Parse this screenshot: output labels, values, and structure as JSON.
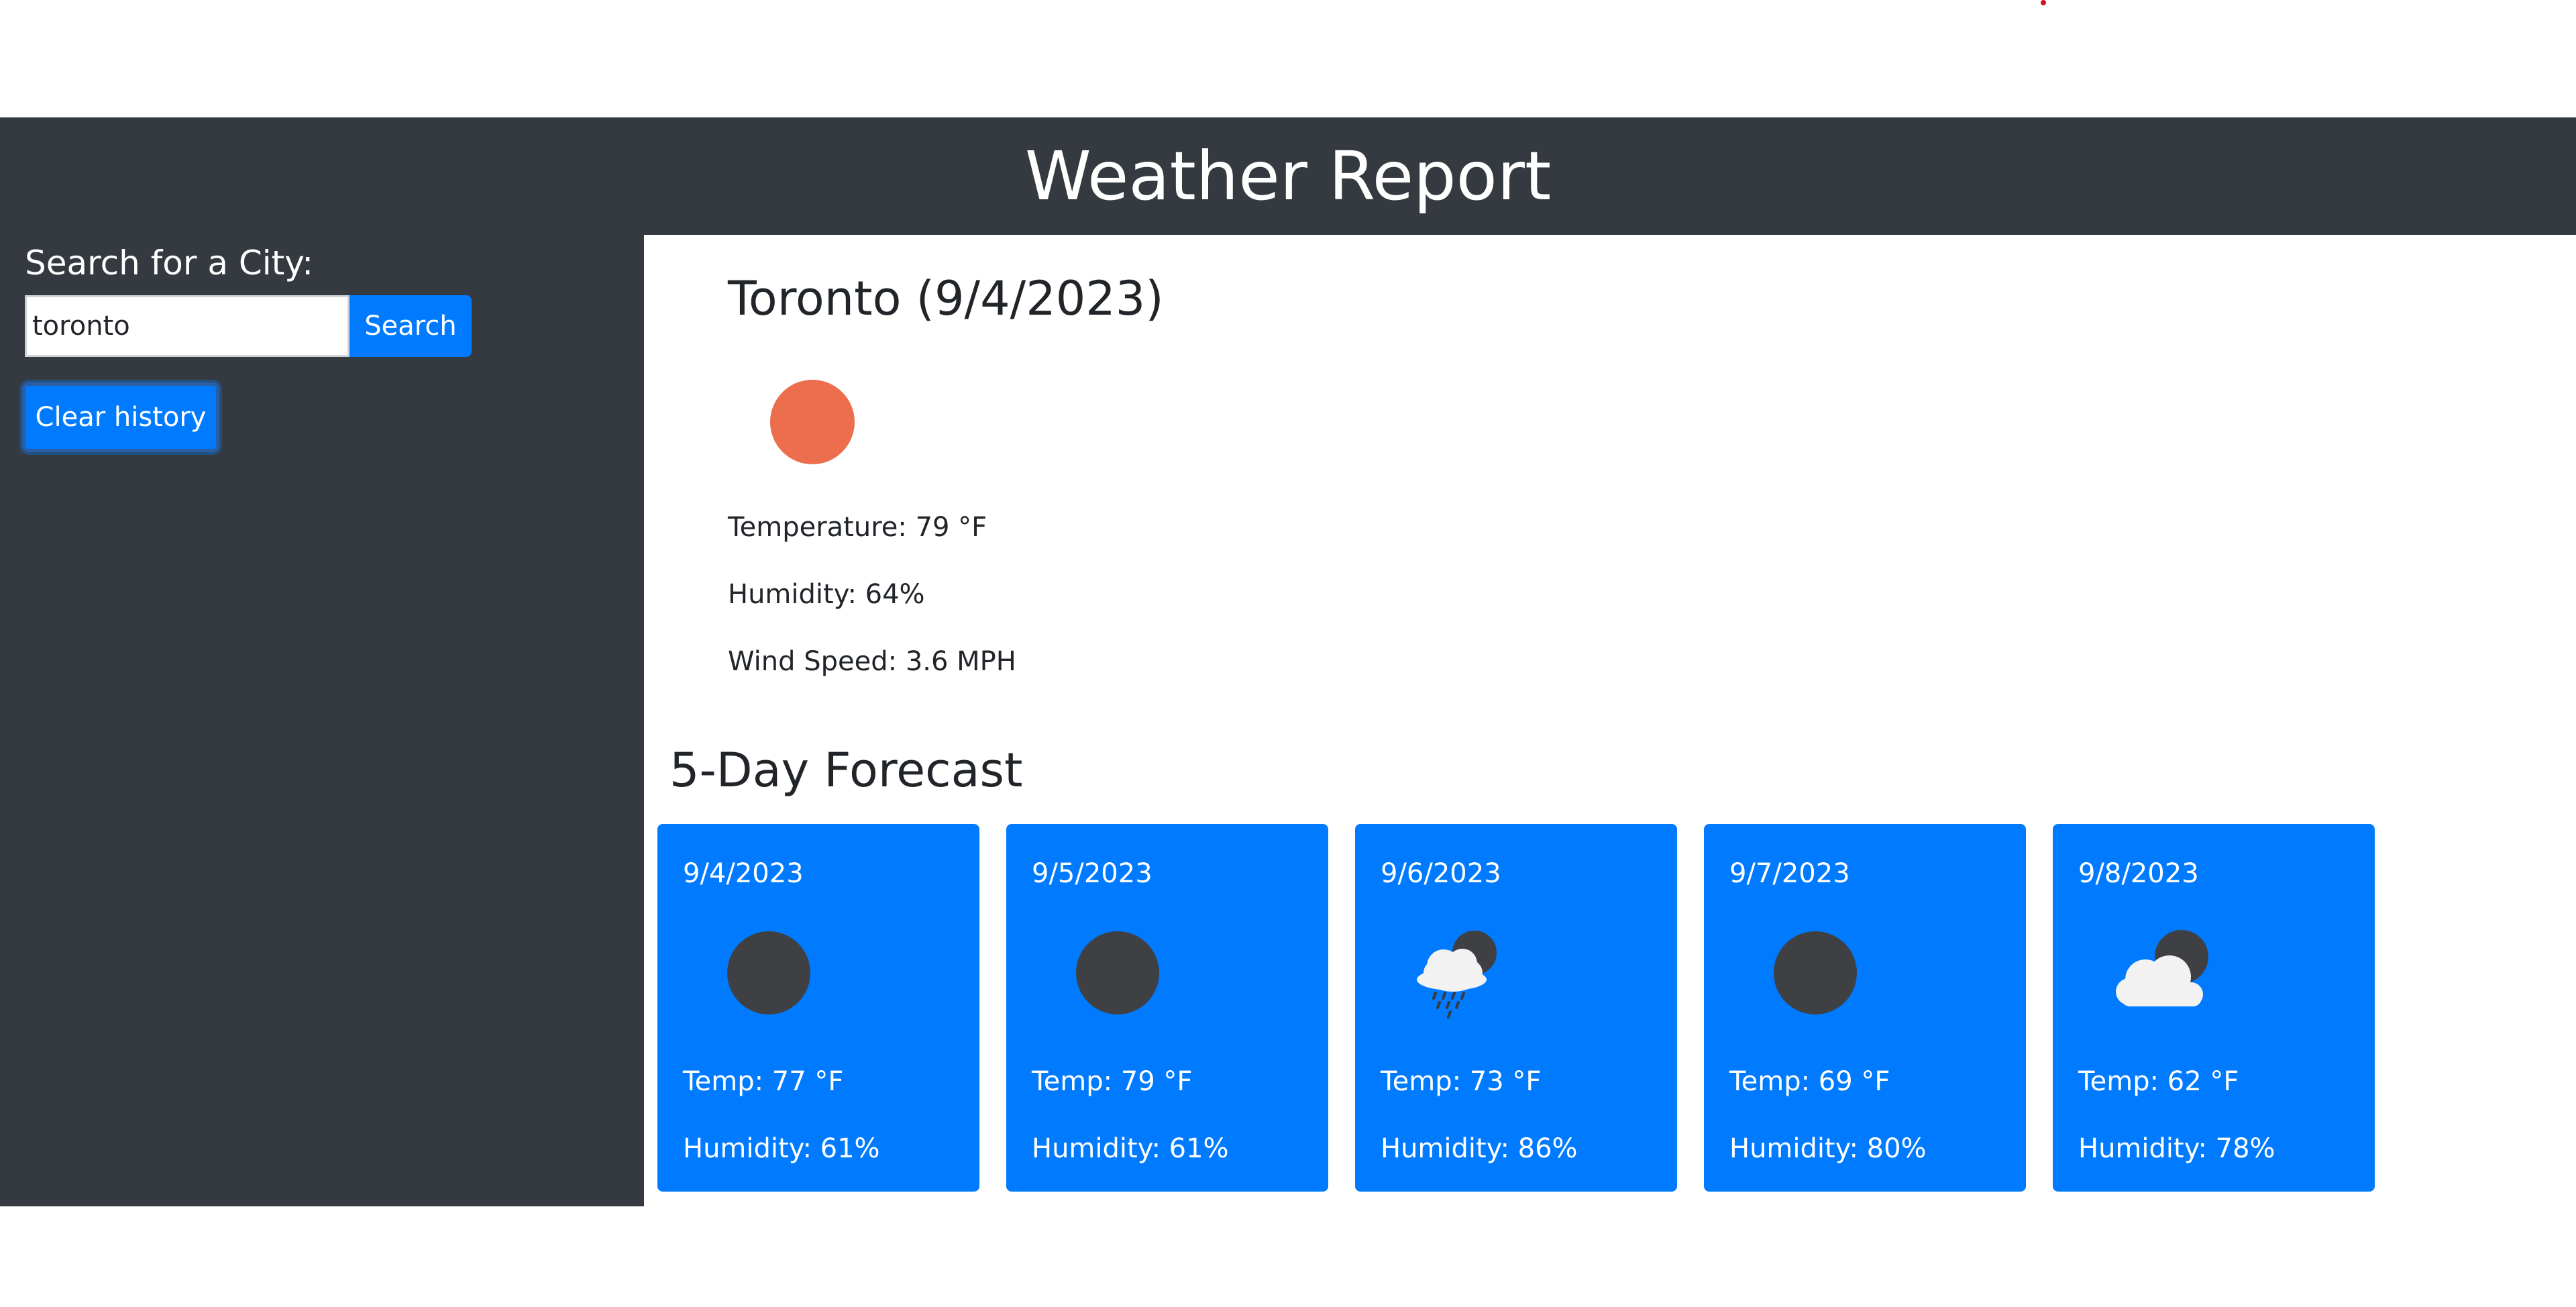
{
  "header": {
    "title": "Weather Report"
  },
  "sidebar": {
    "label": "Search for a City:",
    "search_value": "toronto",
    "search_button": "Search",
    "clear_button": "Clear history"
  },
  "current": {
    "title": "Toronto (9/4/2023)",
    "icon": "clear-day-sun-icon",
    "icon_color": "#ec6e4c",
    "temperature": "Temperature: 79 °F",
    "humidity": "Humidity: 64%",
    "wind": "Wind Speed: 3.6 MPH"
  },
  "forecast": {
    "title": "5-Day Forecast",
    "card_color": "#007bff",
    "days": [
      {
        "date": "9/4/2023",
        "icon": "clear-night-icon",
        "temp": "Temp: 77 °F",
        "humidity": "Humidity: 61%"
      },
      {
        "date": "9/5/2023",
        "icon": "clear-night-icon",
        "temp": "Temp: 79 °F",
        "humidity": "Humidity: 61%"
      },
      {
        "date": "9/6/2023",
        "icon": "rain-night-icon",
        "temp": "Temp: 73 °F",
        "humidity": "Humidity: 86%"
      },
      {
        "date": "9/7/2023",
        "icon": "clear-night-icon",
        "temp": "Temp: 69 °F",
        "humidity": "Humidity: 80%"
      },
      {
        "date": "9/8/2023",
        "icon": "cloudy-night-icon",
        "temp": "Temp: 62 °F",
        "humidity": "Humidity: 78%"
      }
    ]
  }
}
